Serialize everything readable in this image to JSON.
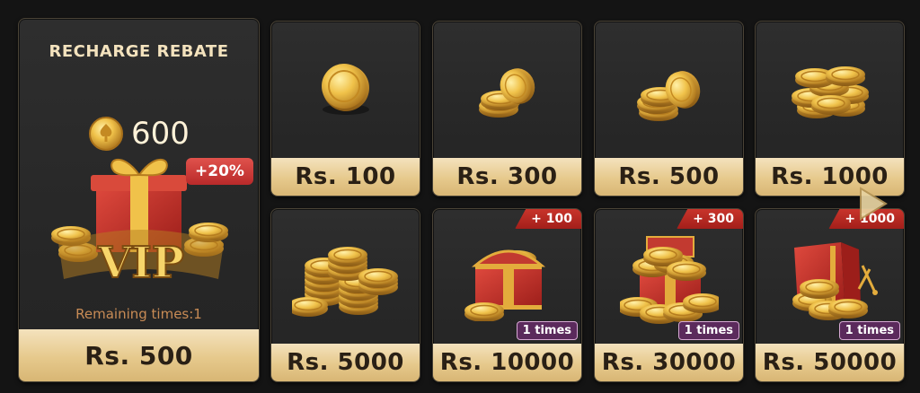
{
  "rebate": {
    "title": "RECHARGE REBATE",
    "coin_amount": "600",
    "percent_badge": "+20%",
    "vip_label": "VIP",
    "remaining": "Remaining times:1",
    "price": "Rs. 500"
  },
  "packages": [
    {
      "price": "Rs. 100",
      "art": "single-coin-icon"
    },
    {
      "price": "Rs. 300",
      "art": "coin-pair-icon"
    },
    {
      "price": "Rs. 500",
      "art": "coin-stack-small-icon"
    },
    {
      "price": "Rs. 1000",
      "art": "coin-pile-icon"
    },
    {
      "price": "Rs. 5000",
      "art": "coin-towers-icon"
    },
    {
      "price": "Rs. 10000",
      "art": "treasure-chest-icon",
      "bonus": "+ 100",
      "times": "1 times"
    },
    {
      "price": "Rs. 30000",
      "art": "treasure-chest-full-icon",
      "bonus": "+ 300",
      "times": "1 times"
    },
    {
      "price": "Rs. 50000",
      "art": "vault-safe-icon",
      "bonus": "+ 1000",
      "times": "1 times"
    }
  ],
  "colors": {
    "price_bar": "#e6c98c",
    "bonus_tag": "#c8342b",
    "times_tag": "#5b2a5c",
    "coin_gold": "#e6b23a"
  }
}
